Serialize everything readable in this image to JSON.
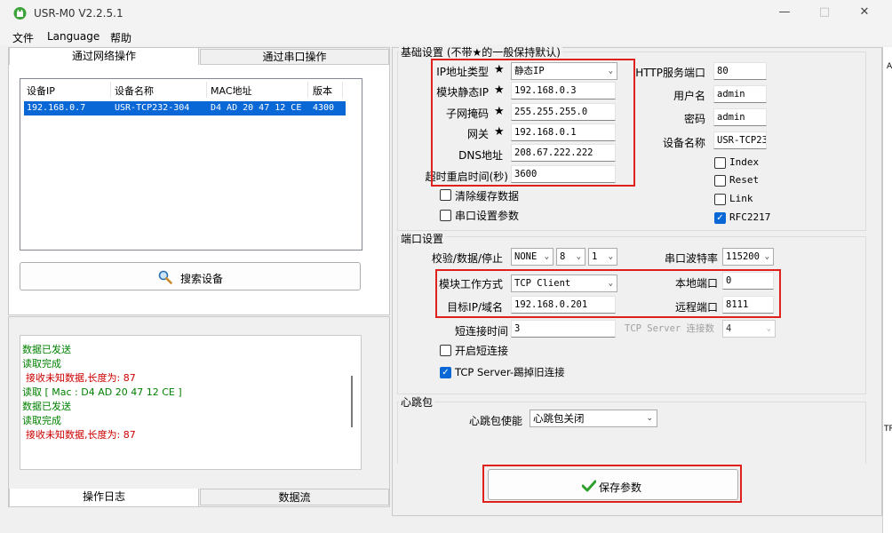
{
  "window": {
    "title": "USR-M0 V2.2.5.1"
  },
  "menu": [
    "文件",
    "Language",
    "帮助"
  ],
  "left": {
    "tabs": [
      "通过网络操作",
      "通过串口操作"
    ],
    "table": {
      "headers": [
        "设备IP",
        "设备名称",
        "MAC地址",
        "版本"
      ],
      "rows": [
        [
          "192.168.0.7",
          "USR-TCP232-304",
          "D4 AD 20 47 12 CE",
          "4300"
        ]
      ]
    },
    "search_button": "搜索设备",
    "log": [
      {
        "text": "数据已发送",
        "color": "green"
      },
      {
        "text": "读取完成",
        "color": "green"
      },
      {
        "text": " 接收未知数据,长度为: 87",
        "color": "red"
      },
      {
        "text": "读取 [ Mac : D4 AD 20 47 12 CE ]",
        "color": "green"
      },
      {
        "text": "数据已发送",
        "color": "green"
      },
      {
        "text": "读取完成",
        "color": "green"
      },
      {
        "text": " 接收未知数据,长度为: 87",
        "color": "red"
      }
    ],
    "bottom_tabs": [
      "操作日志",
      "数据流"
    ]
  },
  "basic": {
    "title": "基础设置 (不带★的一般保持默认)",
    "star": "★",
    "ip_type_label": "IP地址类型",
    "ip_type_value": "静态IP",
    "static_ip_label": "模块静态IP",
    "static_ip_value": "192.168.0.3",
    "subnet_label": "子网掩码",
    "subnet_value": "255.255.255.0",
    "gateway_label": "网关",
    "gateway_value": "192.168.0.1",
    "dns_label": "DNS地址",
    "dns_value": "208.67.222.222",
    "timeout_label": "超时重启时间(秒)",
    "timeout_value": "3600",
    "clear_cache_label": "清除缓存数据",
    "serial_params_label": "串口设置参数",
    "http_port_label": "HTTP服务端口",
    "http_port_value": "80",
    "username_label": "用户名",
    "username_value": "admin",
    "password_label": "密码",
    "password_value": "admin",
    "device_name_label": "设备名称",
    "device_name_value": "USR-TCP23",
    "index_label": "Index",
    "reset_label": "Reset",
    "link_label": "Link",
    "rfc_label": "RFC2217",
    "rfc_checked": true
  },
  "port": {
    "title": "端口设置",
    "parity_label": "校验/数据/停止",
    "parity_value": "NONE",
    "data_bits_value": "8",
    "stop_bits_value": "1",
    "baud_label": "串口波特率",
    "baud_value": "115200",
    "mode_label": "模块工作方式",
    "mode_value": "TCP Client",
    "local_port_label": "本地端口",
    "local_port_value": "0",
    "target_label": "目标IP/域名",
    "target_value": "192.168.0.201",
    "remote_port_label": "远程端口",
    "remote_port_value": "8111",
    "short_conn_label": "短连接时间",
    "short_conn_value": "3",
    "tcp_server_conn_label": "TCP Server 连接数",
    "tcp_server_conn_value": "4",
    "enable_short_label": "开启短连接",
    "kick_old_label": "TCP Server-踢掉旧连接",
    "kick_old_checked": true
  },
  "heartbeat": {
    "title": "心跳包",
    "enable_label": "心跳包使能",
    "enable_value": "心跳包关闭"
  },
  "save_button": "保存参数",
  "right_edge": {
    "a": "A",
    "tri": "TRI"
  },
  "colors": {
    "highlight_red": "#e0201c",
    "selection_blue": "#0a68d6",
    "log_green": "#008000",
    "log_red": "#cc0000"
  }
}
